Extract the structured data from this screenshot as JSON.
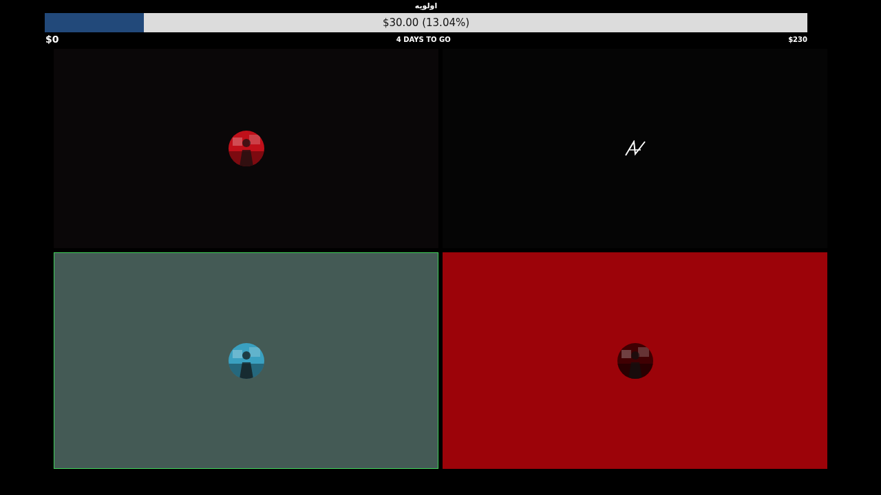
{
  "goal": {
    "title": "اولویه",
    "amount": "$30.00 (13.04%)",
    "level": 0.1304,
    "min": "$0",
    "remaining": "4 DAYS TO GO",
    "max": "$230"
  },
  "tiles": [
    {
      "color": "#0a0708",
      "active": false
    },
    {
      "color": "#050505",
      "active": false,
      "avatar": {
        "kind": "logo"
      }
    },
    {
      "color": "#445a55",
      "active": true
    },
    {
      "color": "#9c0309",
      "active": false
    }
  ]
}
